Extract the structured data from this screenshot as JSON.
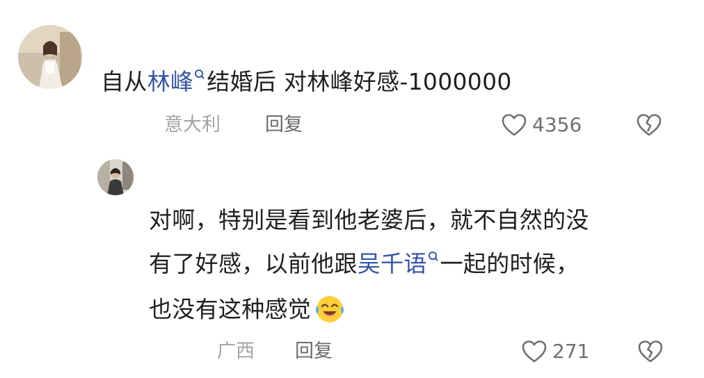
{
  "comment": {
    "text_before": "自从",
    "link_text": "林峰",
    "text_after": "结婚后 对林峰好感-1000000",
    "location": "意大利",
    "reply_label": "回复",
    "like_count": "4356",
    "avatar_icon": "woman-in-white-dress-avatar"
  },
  "reply": {
    "line1": "对啊，特别是看到他老婆后，就不自然的没",
    "line2_before": "有了好感，以前他跟",
    "link_text": "吴千语",
    "line2_after": "一起的时候，",
    "line3": "也没有这种感觉",
    "emoji_icon": "crying-laughing-face-icon",
    "location": "广西",
    "reply_label": "回复",
    "like_count": "271",
    "avatar_icon": "person-photo-avatar"
  },
  "colors": {
    "link": "#3556a7",
    "meta": "#a3a3a3",
    "text": "#1f1f1f"
  }
}
